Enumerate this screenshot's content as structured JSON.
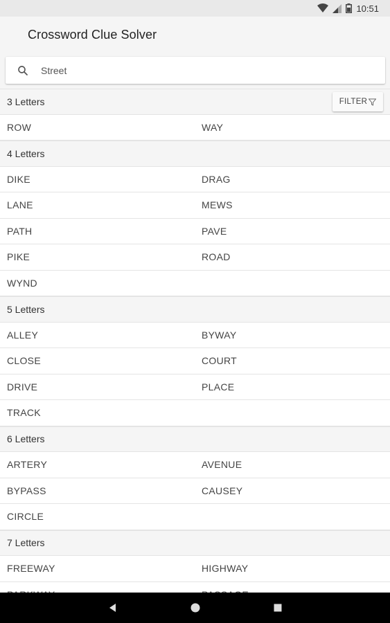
{
  "status_bar": {
    "time": "10:51",
    "icons": [
      "wifi-icon",
      "cell-signal-icon",
      "battery-icon"
    ]
  },
  "app": {
    "title": "Crossword Clue Solver"
  },
  "search": {
    "value": "Street",
    "icon": "search-icon"
  },
  "filter_button": {
    "label": "FILTER",
    "icon": "filter-funnel-icon"
  },
  "sections": [
    {
      "label": "3 Letters",
      "words": [
        "ROW",
        "WAY"
      ]
    },
    {
      "label": "4 Letters",
      "words": [
        "DIKE",
        "DRAG",
        "LANE",
        "MEWS",
        "PATH",
        "PAVE",
        "PIKE",
        "ROAD",
        "WYND"
      ]
    },
    {
      "label": "5 Letters",
      "words": [
        "ALLEY",
        "BYWAY",
        "CLOSE",
        "COURT",
        "DRIVE",
        "PLACE",
        "TRACK"
      ]
    },
    {
      "label": "6 Letters",
      "words": [
        "ARTERY",
        "AVENUE",
        "BYPASS",
        "CAUSEY",
        "CIRCLE"
      ]
    },
    {
      "label": "7 Letters",
      "words": [
        "FREEWAY",
        "HIGHWAY",
        "PARKWAY",
        "PASSAGE"
      ]
    }
  ],
  "nav_bar": {
    "icons": [
      "back-icon",
      "home-icon",
      "recents-icon"
    ]
  }
}
